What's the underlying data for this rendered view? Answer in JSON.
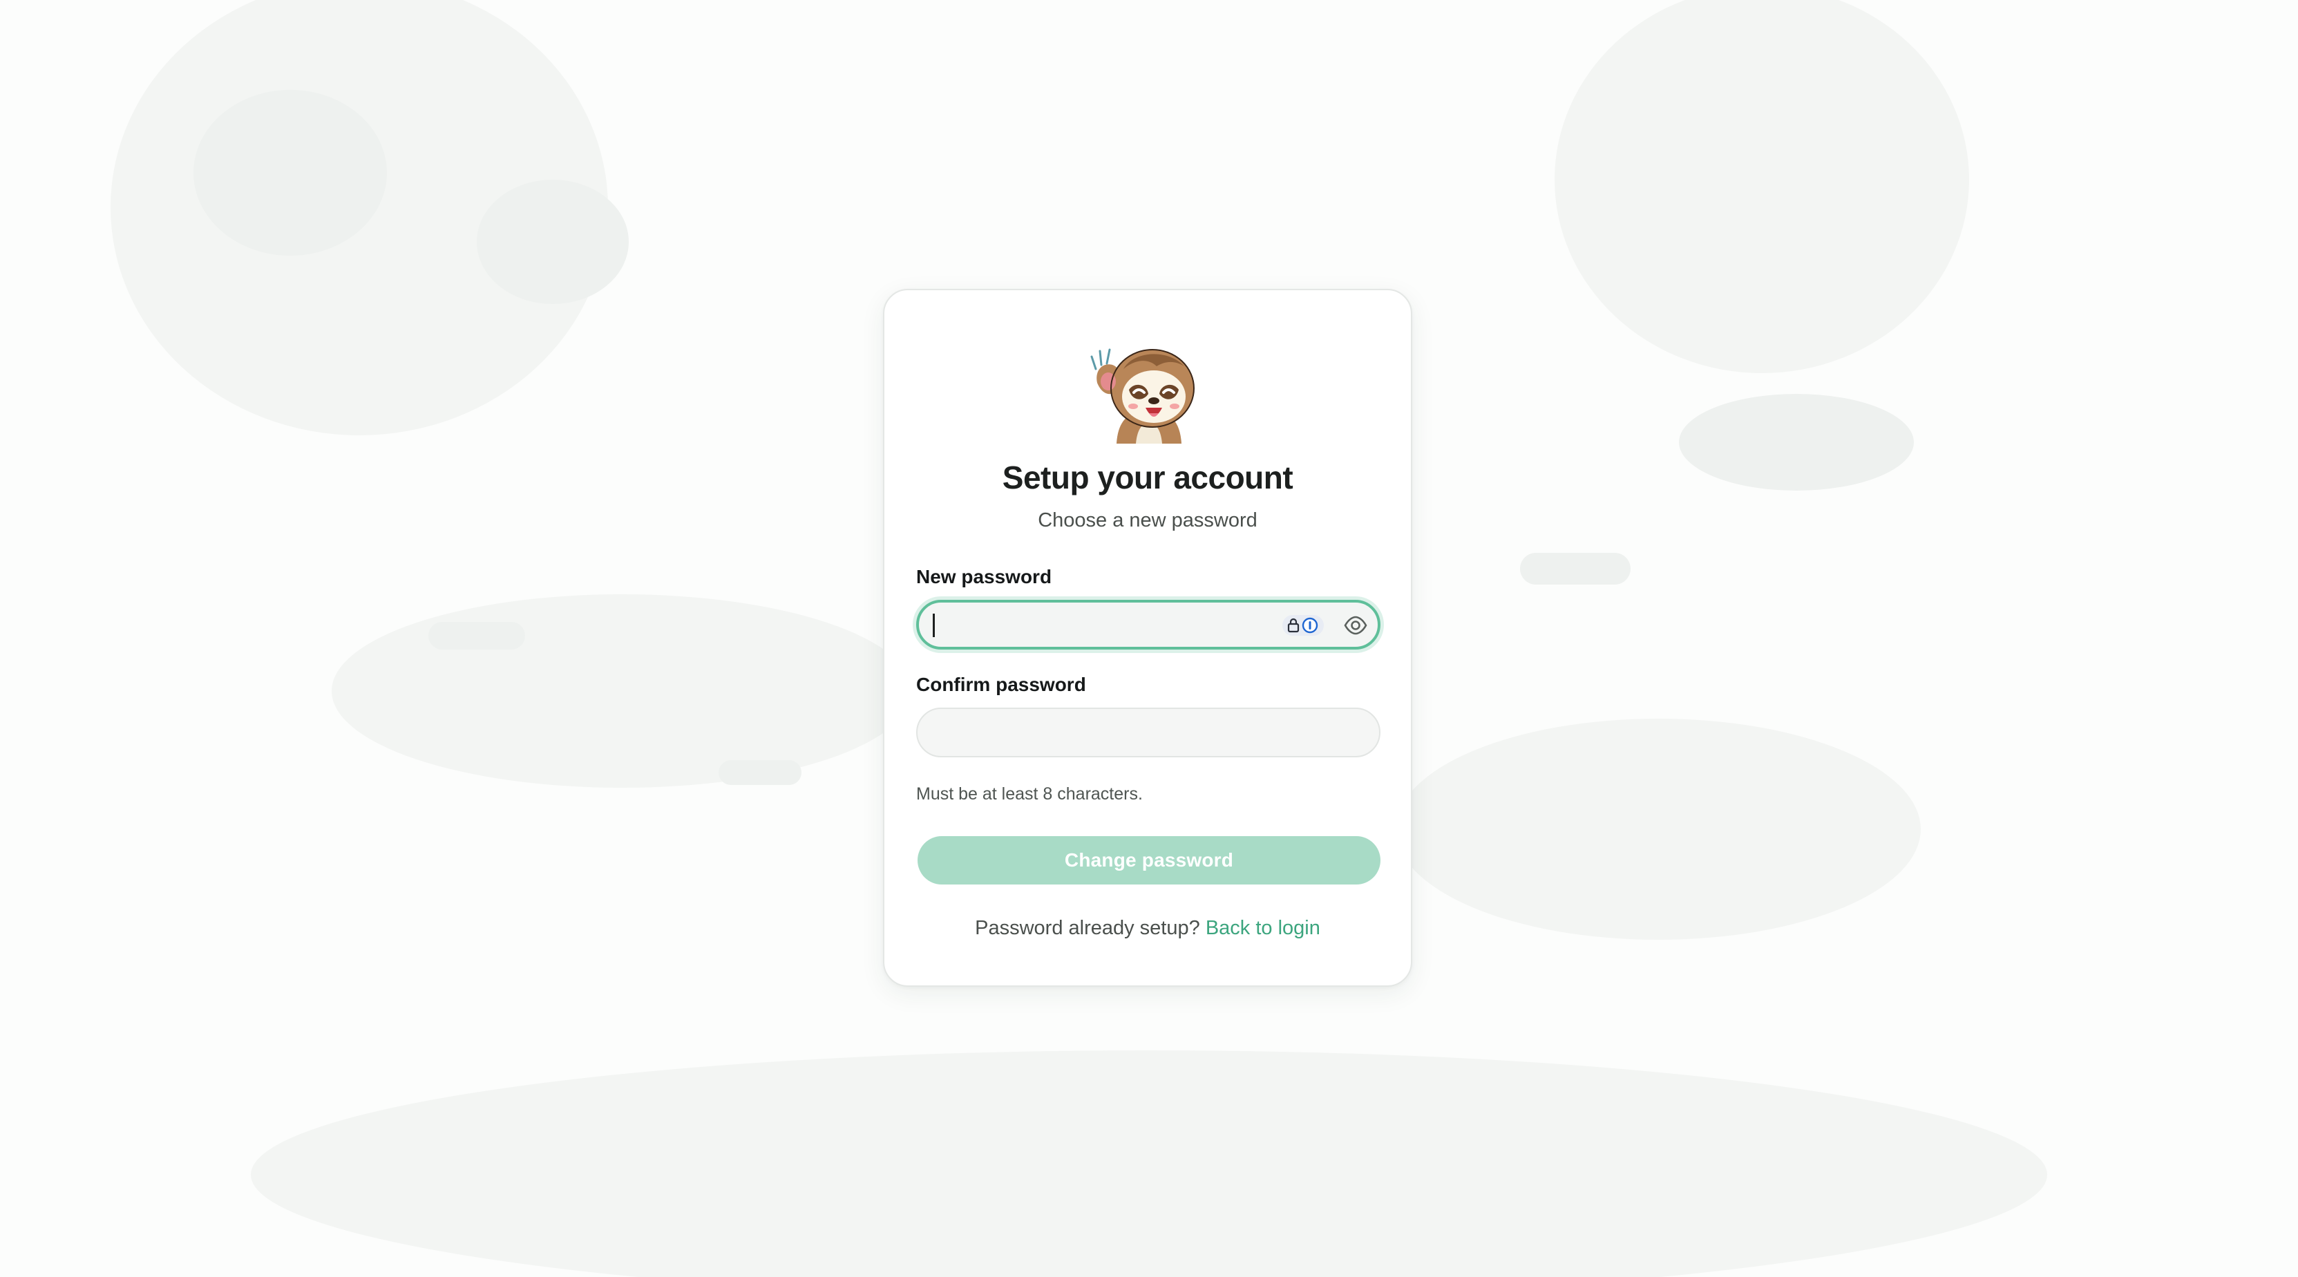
{
  "card": {
    "title": "Setup your account",
    "subtitle": "Choose a new password"
  },
  "form": {
    "new_password": {
      "label": "New password",
      "value": "",
      "placeholder": ""
    },
    "confirm_password": {
      "label": "Confirm password",
      "value": "",
      "placeholder": ""
    },
    "hint": "Must be at least 8 characters.",
    "submit_label": "Change password"
  },
  "footer": {
    "prompt": "Password already setup?",
    "link_label": "Back to login"
  },
  "icons": {
    "mascot": "sloth-waving-mascot",
    "password_manager": "password-manager-icon",
    "toggle_visibility": "eye-icon"
  },
  "colors": {
    "accent": "#3ca57e",
    "focus_ring": "#5fbf9a",
    "button_disabled": "#a8dbc6",
    "card_background": "#ffffff",
    "page_background": "#fcfdfc"
  }
}
